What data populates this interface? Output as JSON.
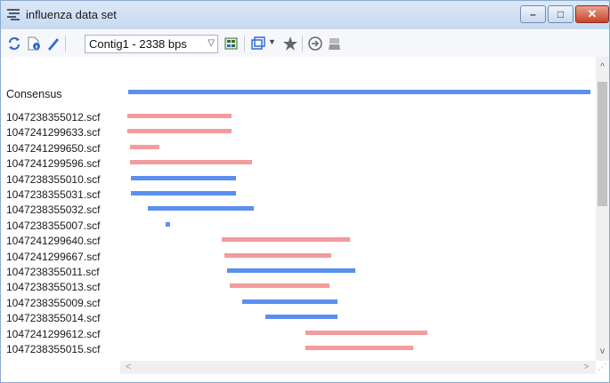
{
  "window": {
    "title": "influenza data set"
  },
  "toolbar": {
    "contig_select": "Contig1 - 2338 bps",
    "buttons": [
      "refresh-icon",
      "document-info-icon",
      "pencil-icon",
      "pin-grid-icon",
      "window-icon",
      "star-icon",
      "arrow-circle-icon",
      "broom-icon"
    ]
  },
  "colors": {
    "forward": "#f39b9d",
    "reverse": "#5b8ff0",
    "consensus": "#5b8ff0"
  },
  "alignment": {
    "consensus_label": "Consensus",
    "contig_length_bp": 2338,
    "reads": [
      {
        "name": "1047238355012.scf",
        "start": 0.0,
        "end": 0.226,
        "dir": "forward"
      },
      {
        "name": "1047241299633.scf",
        "start": 0.0,
        "end": 0.226,
        "dir": "forward"
      },
      {
        "name": "1047241299650.scf",
        "start": 0.006,
        "end": 0.069,
        "dir": "forward"
      },
      {
        "name": "1047241299596.scf",
        "start": 0.006,
        "end": 0.269,
        "dir": "forward"
      },
      {
        "name": "1047238355010.scf",
        "start": 0.008,
        "end": 0.235,
        "dir": "reverse"
      },
      {
        "name": "1047238355031.scf",
        "start": 0.008,
        "end": 0.235,
        "dir": "reverse"
      },
      {
        "name": "1047238355032.scf",
        "start": 0.044,
        "end": 0.273,
        "dir": "reverse"
      },
      {
        "name": "1047238355007.scf",
        "start": 0.083,
        "end": 0.093,
        "dir": "reverse"
      },
      {
        "name": "1047241299640.scf",
        "start": 0.204,
        "end": 0.482,
        "dir": "forward"
      },
      {
        "name": "1047241299667.scf",
        "start": 0.21,
        "end": 0.441,
        "dir": "forward"
      },
      {
        "name": "1047238355011.scf",
        "start": 0.216,
        "end": 0.493,
        "dir": "reverse"
      },
      {
        "name": "1047238355013.scf",
        "start": 0.222,
        "end": 0.437,
        "dir": "forward"
      },
      {
        "name": "1047238355009.scf",
        "start": 0.249,
        "end": 0.454,
        "dir": "reverse"
      },
      {
        "name": "1047238355014.scf",
        "start": 0.299,
        "end": 0.454,
        "dir": "reverse"
      },
      {
        "name": "1047241299612.scf",
        "start": 0.385,
        "end": 0.649,
        "dir": "forward"
      },
      {
        "name": "1047238355015.scf",
        "start": 0.385,
        "end": 0.618,
        "dir": "forward"
      }
    ]
  },
  "scrollbar": {
    "vertical_position": 0.0
  }
}
